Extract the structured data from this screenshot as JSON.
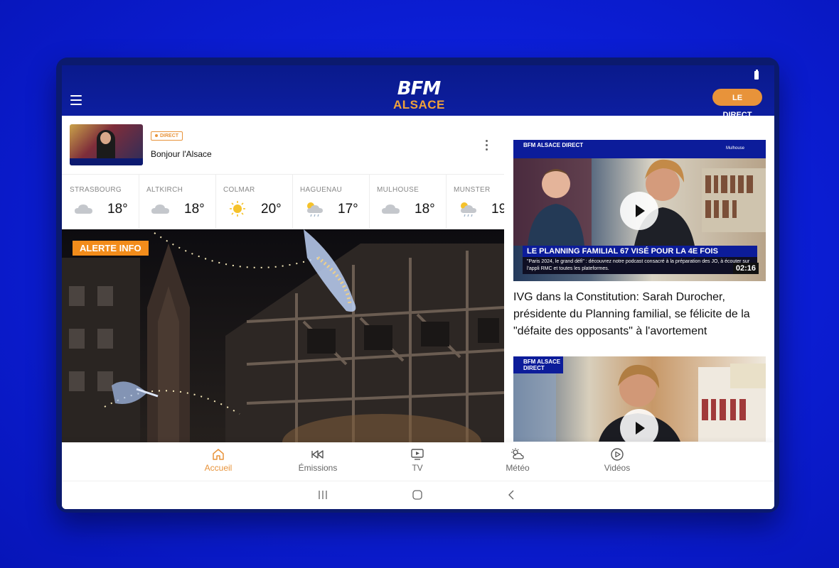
{
  "header": {
    "brand": "BFM",
    "region": "ALSACE",
    "live_button": "LE DIRECT"
  },
  "live_card": {
    "badge": "DIRECT",
    "title": "Bonjour l'Alsace"
  },
  "weather": [
    {
      "city": "STRASBOURG",
      "temp": "18°",
      "icon": "cloud-icon"
    },
    {
      "city": "ALTKIRCH",
      "temp": "18°",
      "icon": "cloud-icon"
    },
    {
      "city": "COLMAR",
      "temp": "20°",
      "icon": "sun-icon"
    },
    {
      "city": "HAGUENAU",
      "temp": "17°",
      "icon": "sun-cloud-rain-icon"
    },
    {
      "city": "MULHOUSE",
      "temp": "18°",
      "icon": "cloud-icon"
    },
    {
      "city": "MUNSTER",
      "temp": "19",
      "icon": "sun-cloud-rain-icon"
    }
  ],
  "hero": {
    "alert": "ALERTE INFO"
  },
  "video1": {
    "channel": "BFM ALSACE DIRECT",
    "location": "Mulhouse",
    "lower_third": "LE PLANNING FAMILIAL 67 VISÉ POUR LA 4E FOIS",
    "subtitle": "\"Paris 2024, le grand défi\" : découvrez notre podcast consacré à la préparation des JO, à écouter sur l'appli RMC et toutes les plateformes.",
    "duration": "02:16"
  },
  "article": {
    "title": "IVG dans la Constitution: Sarah Durocher, présidente du Planning familial, se félicite de la \"défaite des opposants\" à l'avortement"
  },
  "video2": {
    "channel": "BFM ALSACE DIRECT"
  },
  "nav": [
    {
      "label": "Accueil",
      "icon": "home-icon",
      "active": true
    },
    {
      "label": "Émissions",
      "icon": "rewind-icon",
      "active": false
    },
    {
      "label": "TV",
      "icon": "tv-icon",
      "active": false
    },
    {
      "label": "Météo",
      "icon": "weather-icon",
      "active": false
    },
    {
      "label": "Vidéos",
      "icon": "play-circle-icon",
      "active": false
    }
  ],
  "colors": {
    "background": "#0c1fd8",
    "header": "#0a1a8c",
    "accent": "#e8933a",
    "alert": "#f28c1b"
  }
}
